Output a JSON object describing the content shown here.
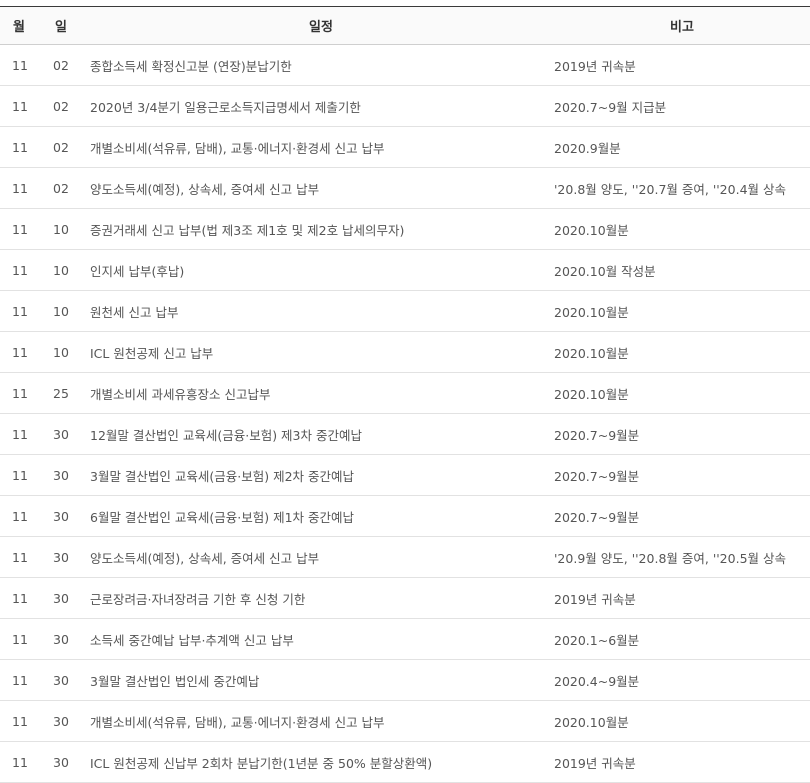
{
  "table": {
    "headers": {
      "month": "월",
      "day": "일",
      "schedule": "일정",
      "note": "비고"
    },
    "rows": [
      {
        "month": "11",
        "day": "02",
        "schedule": "종합소득세 확정신고분 (연장)분납기한",
        "note": "2019년 귀속분"
      },
      {
        "month": "11",
        "day": "02",
        "schedule": "2020년 3/4분기 일용근로소득지급명세서 제출기한",
        "note": "2020.7~9월 지급분"
      },
      {
        "month": "11",
        "day": "02",
        "schedule": "개별소비세(석유류, 담배), 교통·에너지·환경세 신고 납부",
        "note": "2020.9월분"
      },
      {
        "month": "11",
        "day": "02",
        "schedule": "양도소득세(예정), 상속세, 증여세 신고 납부",
        "note": "'20.8월 양도, ''20.7월 증여, ''20.4월 상속"
      },
      {
        "month": "11",
        "day": "10",
        "schedule": "증권거래세 신고 납부(법 제3조 제1호 및 제2호 납세의무자)",
        "note": "2020.10월분"
      },
      {
        "month": "11",
        "day": "10",
        "schedule": "인지세 납부(후납)",
        "note": "2020.10월 작성분"
      },
      {
        "month": "11",
        "day": "10",
        "schedule": "원천세 신고 납부",
        "note": "2020.10월분"
      },
      {
        "month": "11",
        "day": "10",
        "schedule": "ICL 원천공제 신고 납부",
        "note": "2020.10월분"
      },
      {
        "month": "11",
        "day": "25",
        "schedule": "개별소비세 과세유흥장소 신고납부",
        "note": "2020.10월분"
      },
      {
        "month": "11",
        "day": "30",
        "schedule": "12월말 결산법인 교육세(금융·보험) 제3차 중간예납",
        "note": "2020.7~9월분"
      },
      {
        "month": "11",
        "day": "30",
        "schedule": "3월말 결산법인 교육세(금융·보험) 제2차 중간예납",
        "note": "2020.7~9월분"
      },
      {
        "month": "11",
        "day": "30",
        "schedule": "6월말 결산법인 교육세(금융·보험) 제1차 중간예납",
        "note": "2020.7~9월분"
      },
      {
        "month": "11",
        "day": "30",
        "schedule": "양도소득세(예정), 상속세, 증여세 신고 납부",
        "note": "'20.9월 양도, ''20.8월 증여, ''20.5월 상속"
      },
      {
        "month": "11",
        "day": "30",
        "schedule": "근로장려금·자녀장려금 기한 후 신청 기한",
        "note": "2019년 귀속분"
      },
      {
        "month": "11",
        "day": "30",
        "schedule": "소득세 중간예납 납부·추계액 신고 납부",
        "note": "2020.1~6월분"
      },
      {
        "month": "11",
        "day": "30",
        "schedule": "3월말 결산법인 법인세 중간예납",
        "note": "2020.4~9월분"
      },
      {
        "month": "11",
        "day": "30",
        "schedule": "개별소비세(석유류, 담배), 교통·에너지·환경세 신고 납부",
        "note": "2020.10월분"
      },
      {
        "month": "11",
        "day": "30",
        "schedule": "ICL 원천공제 신납부 2회차 분납기한(1년분 중 50% 분할상환액)",
        "note": "2019년 귀속분"
      }
    ]
  }
}
